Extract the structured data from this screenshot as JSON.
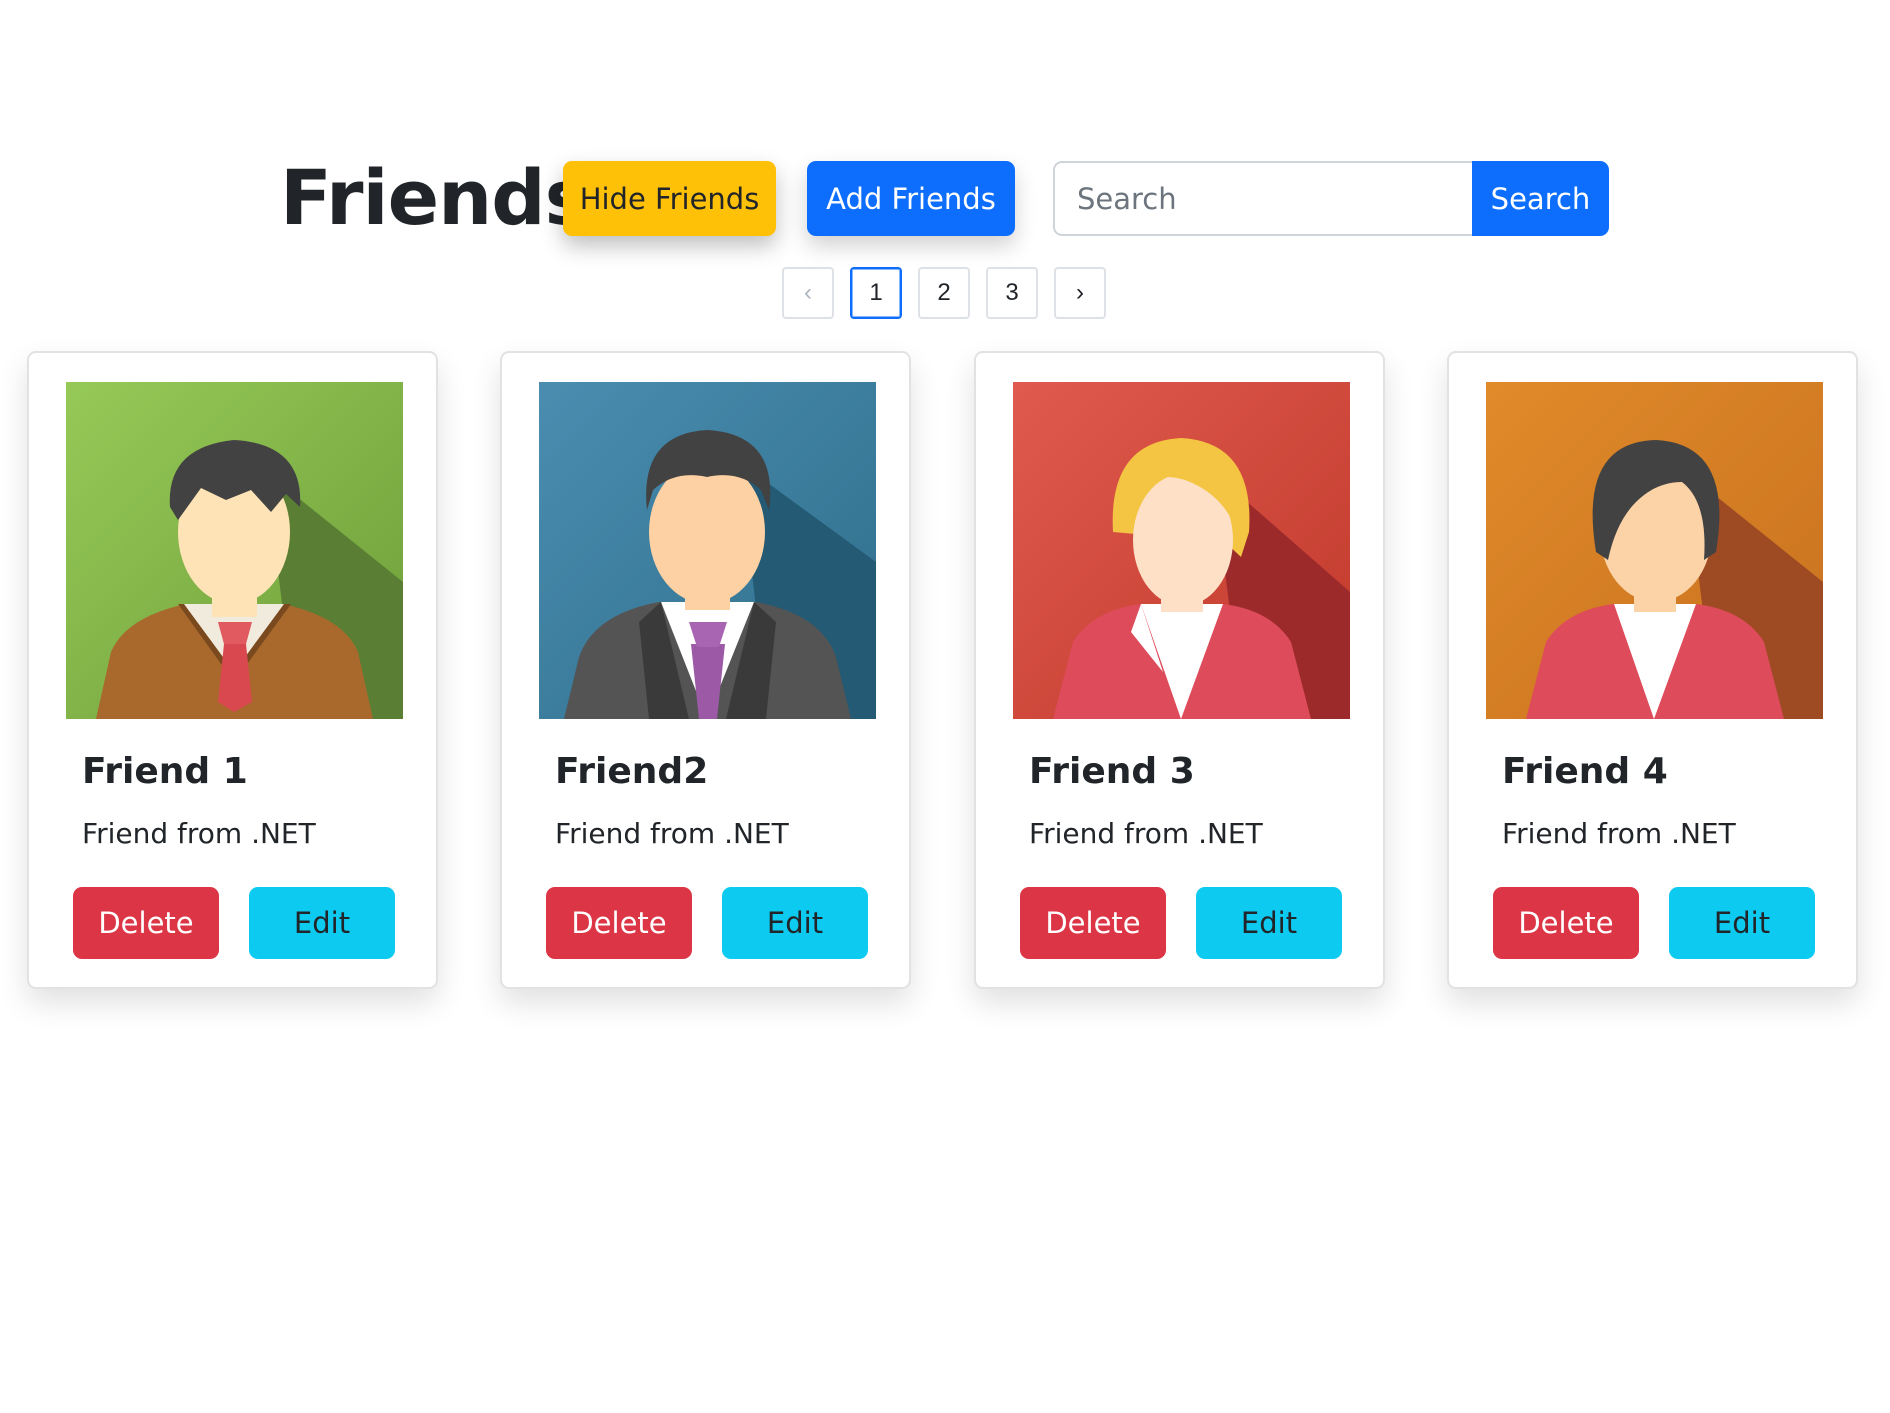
{
  "header": {
    "title": "Friends",
    "hide_label": "Hide Friends",
    "add_label": "Add Friends",
    "search_placeholder": "Search",
    "search_value": "",
    "search_button": "Search"
  },
  "pagination": {
    "prev": "‹",
    "next": "›",
    "pages": [
      "1",
      "2",
      "3"
    ],
    "current": "1"
  },
  "friends": [
    {
      "name": "Friend 1",
      "description": "Friend from .NET",
      "delete_label": "Delete",
      "edit_label": "Edit",
      "avatar_icon": "male-avatar-sweater-icon",
      "background_color": "#8bc34a"
    },
    {
      "name": "Friend2",
      "description": "Friend from .NET",
      "delete_label": "Delete",
      "edit_label": "Edit",
      "avatar_icon": "male-avatar-suit-icon",
      "background_color": "#3f87a6"
    },
    {
      "name": "Friend 3",
      "description": "Friend from .NET",
      "delete_label": "Delete",
      "edit_label": "Edit",
      "avatar_icon": "female-avatar-blonde-icon",
      "background_color": "#d9534f"
    },
    {
      "name": "Friend 4",
      "description": "Friend from .NET",
      "delete_label": "Delete",
      "edit_label": "Edit",
      "avatar_icon": "female-avatar-dark-hair-icon",
      "background_color": "#e08a2a"
    }
  ],
  "colors": {
    "warning": "#ffc107",
    "primary": "#0d6efd",
    "danger": "#dc3545",
    "info": "#0dcaf0"
  }
}
